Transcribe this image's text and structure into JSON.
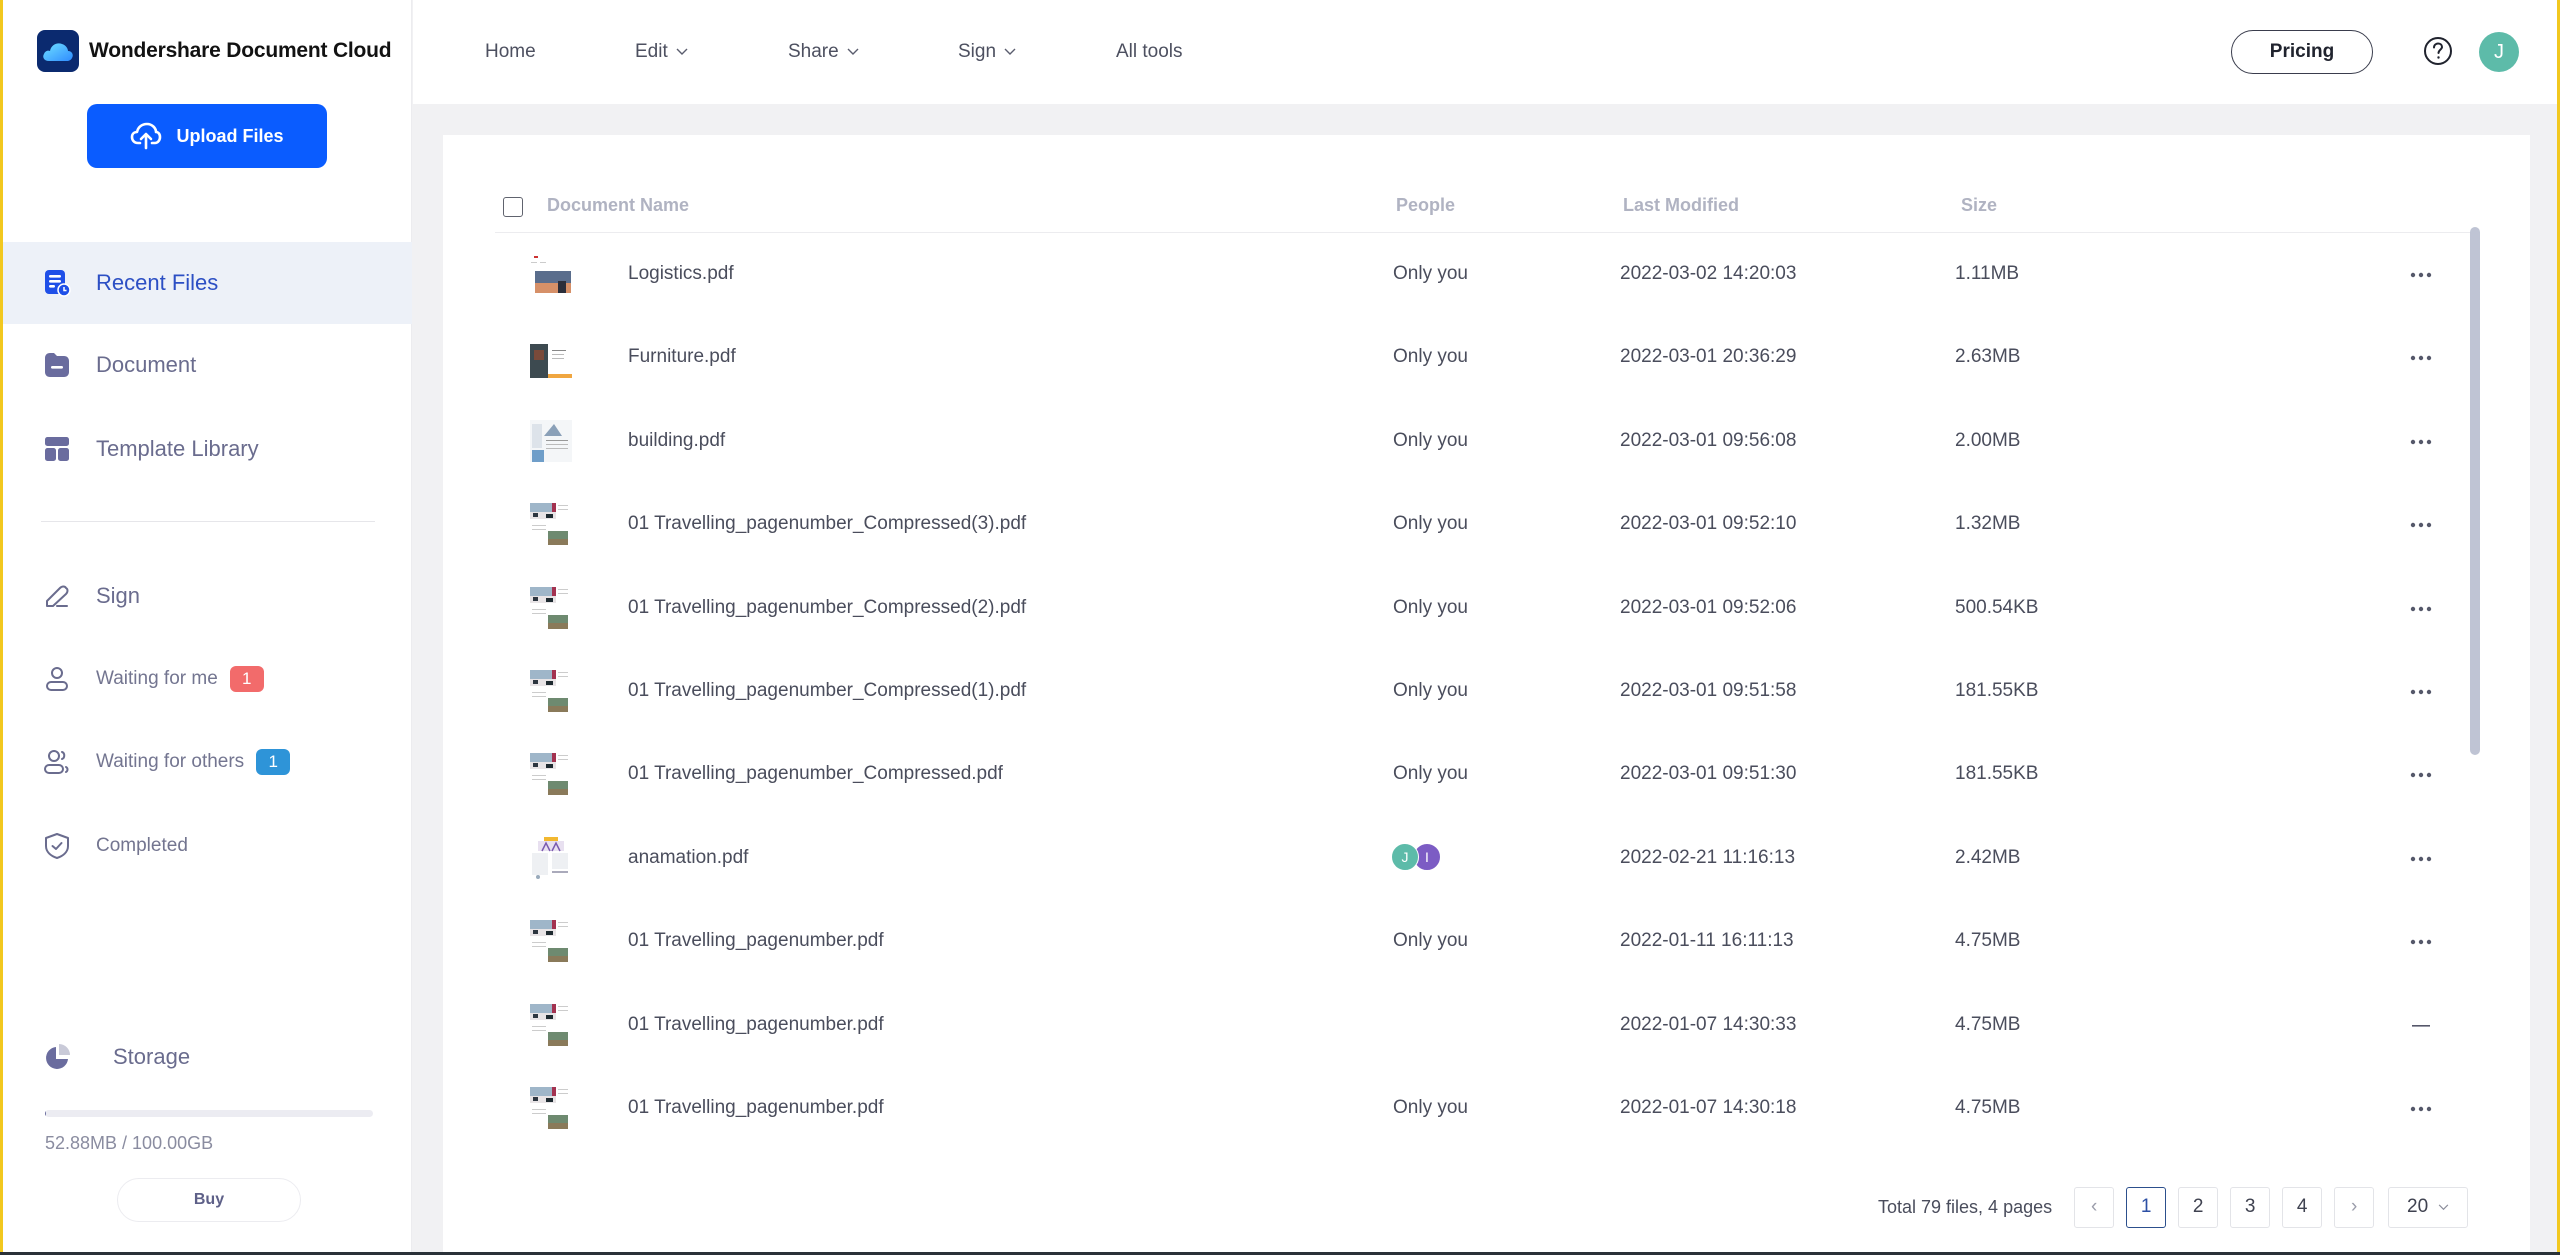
{
  "app": {
    "brand_name": "Wondershare Document Cloud",
    "upload_label": "Upload Files"
  },
  "colors": {
    "primary": "#0a5cff",
    "active_nav_bg": "#edf1f8",
    "active_nav_text": "#2c4fc4",
    "badge_red": "#f26b6b",
    "badge_blue": "#2e94d8",
    "avatar_j": "#5dbba9",
    "avatar_i": "#7c5cc4"
  },
  "sidebar": {
    "nav": [
      {
        "label": "Recent Files",
        "icon": "recent-files-icon",
        "active": true
      },
      {
        "label": "Document",
        "icon": "folder-icon",
        "active": false
      },
      {
        "label": "Template Library",
        "icon": "template-icon",
        "active": false
      }
    ],
    "sign": {
      "label": "Sign",
      "items": [
        {
          "label": "Waiting for me",
          "badge": "1",
          "badge_color": "red"
        },
        {
          "label": "Waiting for others",
          "badge": "1",
          "badge_color": "blue"
        },
        {
          "label": "Completed",
          "badge": null
        }
      ]
    },
    "storage": {
      "label": "Storage",
      "used": "52.88MB",
      "total": "100.00GB",
      "text": "52.88MB / 100.00GB",
      "used_fraction": 0.0005,
      "buy_label": "Buy"
    }
  },
  "topbar": {
    "nav": [
      {
        "label": "Home",
        "dropdown": false
      },
      {
        "label": "Edit",
        "dropdown": true
      },
      {
        "label": "Share",
        "dropdown": true
      },
      {
        "label": "Sign",
        "dropdown": true
      },
      {
        "label": "All tools",
        "dropdown": false
      }
    ],
    "pricing_label": "Pricing",
    "user_initial": "J"
  },
  "table": {
    "columns": [
      "Document Name",
      "People",
      "Last Modified",
      "Size"
    ],
    "rows": [
      {
        "name": "Logistics.pdf",
        "people": "Only you",
        "modified": "2022-03-02 14:20:03",
        "size": "1.11MB",
        "action": "more",
        "thumb": "logistics"
      },
      {
        "name": "Furniture.pdf",
        "people": "Only you",
        "modified": "2022-03-01 20:36:29",
        "size": "2.63MB",
        "action": "more",
        "thumb": "furniture"
      },
      {
        "name": "building.pdf",
        "people": "Only you",
        "modified": "2022-03-01 09:56:08",
        "size": "2.00MB",
        "action": "more",
        "thumb": "building"
      },
      {
        "name": "01 Travelling_pagenumber_Compressed(3).pdf",
        "people": "Only you",
        "modified": "2022-03-01 09:52:10",
        "size": "1.32MB",
        "action": "more",
        "thumb": "travel"
      },
      {
        "name": "01 Travelling_pagenumber_Compressed(2).pdf",
        "people": "Only you",
        "modified": "2022-03-01 09:52:06",
        "size": "500.54KB",
        "action": "more",
        "thumb": "travel"
      },
      {
        "name": "01 Travelling_pagenumber_Compressed(1).pdf",
        "people": "Only you",
        "modified": "2022-03-01 09:51:58",
        "size": "181.55KB",
        "action": "more",
        "thumb": "travel"
      },
      {
        "name": "01 Travelling_pagenumber_Compressed.pdf",
        "people": "Only you",
        "modified": "2022-03-01 09:51:30",
        "size": "181.55KB",
        "action": "more",
        "thumb": "travel"
      },
      {
        "name": "anamation.pdf",
        "people": "",
        "people_avatars": [
          "J",
          "I"
        ],
        "modified": "2022-02-21 11:16:13",
        "size": "2.42MB",
        "action": "more",
        "thumb": "anamation"
      },
      {
        "name": "01 Travelling_pagenumber.pdf",
        "people": "Only you",
        "modified": "2022-01-11 16:11:13",
        "size": "4.75MB",
        "action": "more",
        "thumb": "travel"
      },
      {
        "name": "01 Travelling_pagenumber.pdf",
        "people": "",
        "modified": "2022-01-07 14:30:33",
        "size": "4.75MB",
        "action": "dash",
        "thumb": "travel"
      },
      {
        "name": "01 Travelling_pagenumber.pdf",
        "people": "Only you",
        "modified": "2022-01-07 14:30:18",
        "size": "4.75MB",
        "action": "more",
        "thumb": "travel"
      }
    ]
  },
  "pagination": {
    "summary": "Total 79 files, 4 pages",
    "pages": [
      "1",
      "2",
      "3",
      "4"
    ],
    "current": "1",
    "prev": "‹",
    "next": "›",
    "page_size": "20"
  }
}
